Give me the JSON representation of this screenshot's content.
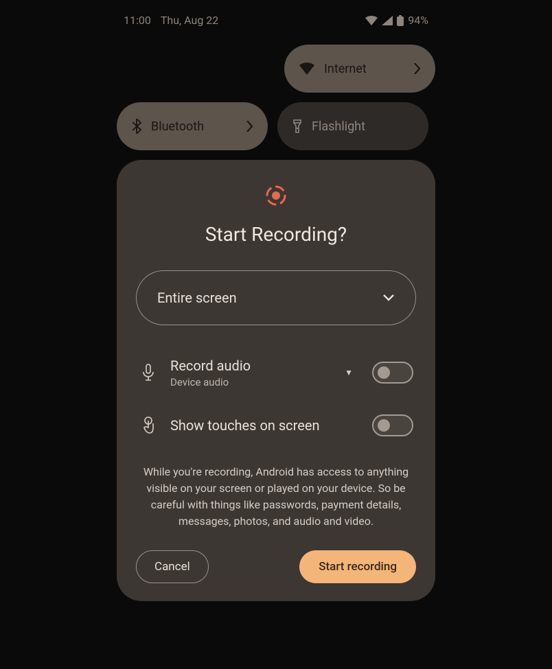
{
  "status": {
    "time": "11:00",
    "date": "Thu, Aug 22",
    "battery": "94%"
  },
  "tiles": {
    "internet": "Internet",
    "bluetooth": "Bluetooth",
    "flashlight": "Flashlight"
  },
  "dialog": {
    "title": "Start Recording?",
    "scope": "Entire screen",
    "audio_title": "Record audio",
    "audio_sub": "Device audio",
    "touches_title": "Show touches on screen",
    "disclaimer": "While you're recording, Android has access to anything visible on your screen or played on your device. So be careful with things like passwords, payment details, messages, photos, and audio and video.",
    "cancel": "Cancel",
    "start": "Start recording"
  }
}
